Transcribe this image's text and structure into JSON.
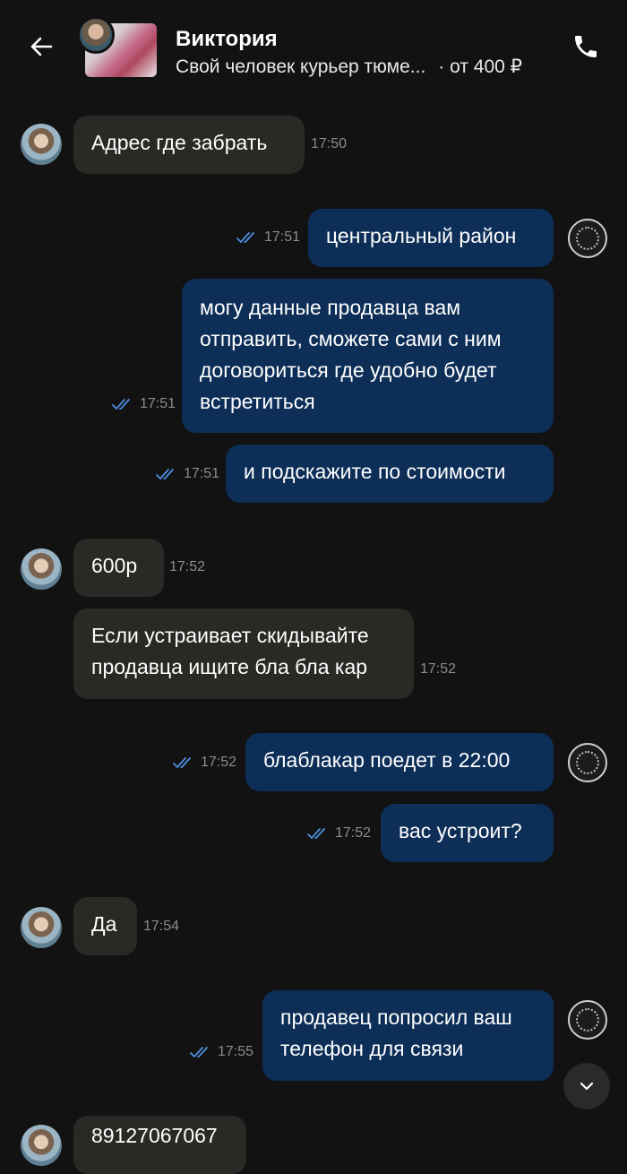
{
  "header": {
    "contact_name": "Виктория",
    "ad_title": "Свой человек курьер тюме...",
    "ad_price": "· от 400 ₽"
  },
  "messages": [
    {
      "dir": "in",
      "text": "Адрес где забрать",
      "time": "17:50"
    },
    {
      "dir": "out",
      "text": "центральный район",
      "time": "17:51"
    },
    {
      "dir": "out",
      "lines": [
        "могу данные продавца вам",
        "отправить, сможете сами с ним",
        "договориться где удобно будет",
        "встретиться"
      ],
      "time": "17:51"
    },
    {
      "dir": "out",
      "text": "и подскажите по стоимости",
      "time": "17:51"
    },
    {
      "dir": "in",
      "text": "600р",
      "time": "17:52"
    },
    {
      "dir": "in",
      "lines": [
        "Если устраивает скидывайте",
        "продавца ищите бла бла кар"
      ],
      "time": "17:52"
    },
    {
      "dir": "out",
      "text": "блаблакар поедет в 22:00",
      "time": "17:52"
    },
    {
      "dir": "out",
      "text": "вас устроит?",
      "time": "17:52"
    },
    {
      "dir": "in",
      "text": "Да",
      "time": "17:54"
    },
    {
      "dir": "out",
      "lines": [
        "продавец попросил ваш",
        "телефон для связи"
      ],
      "time": "17:55"
    },
    {
      "dir": "in",
      "text": "89127067067",
      "time": ""
    }
  ],
  "colors": {
    "background": "#121212",
    "bubble_in": "#2b2925",
    "bubble_out": "#0d2e57",
    "read_ticks": "#4d8fe0"
  },
  "icons": {
    "back": "arrow-left-icon",
    "call": "phone-icon",
    "scroll": "chevron-down-icon",
    "read": "double-check-icon"
  }
}
